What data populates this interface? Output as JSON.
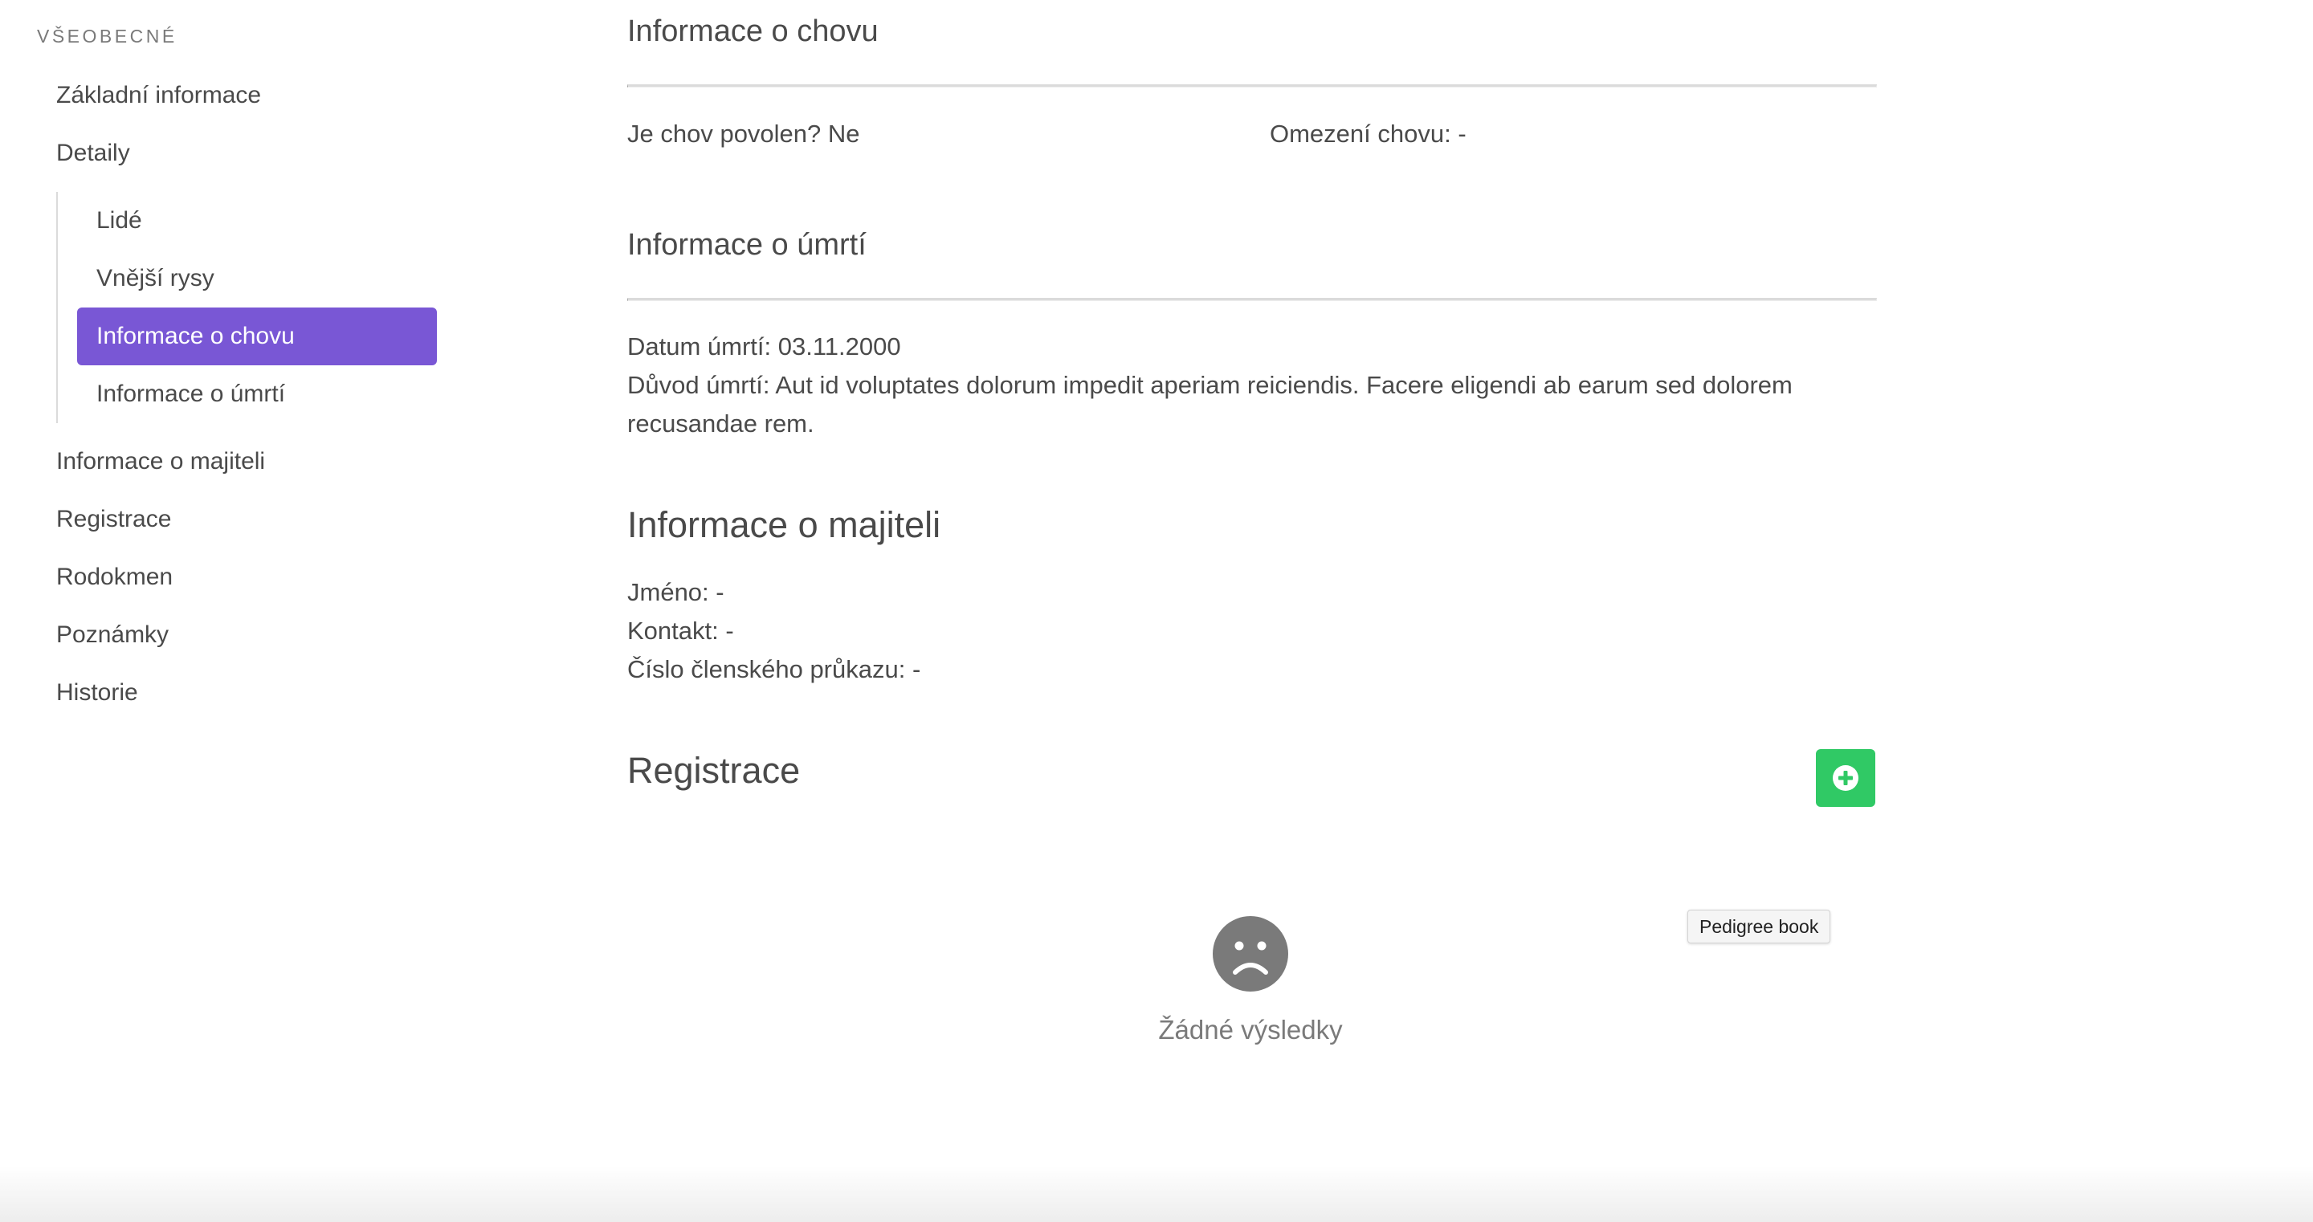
{
  "sidebar": {
    "label": "Všeobecné",
    "items": {
      "basic_info": "Základní informace",
      "details": "Detaily",
      "sub": {
        "people": "Lidé",
        "appearance": "Vnější rysy",
        "breeding_info": "Informace o chovu",
        "death_info": "Informace o úmrtí"
      },
      "owner_info": "Informace o majiteli",
      "registration": "Registrace",
      "pedigree": "Rodokmen",
      "notes": "Poznámky",
      "history": "Historie"
    },
    "active_item": "Informace o chovu",
    "active_color": "#7957d5"
  },
  "breeding": {
    "title": "Informace o chovu",
    "allowed_text": "Je chov povolen? Ne",
    "restriction_text": "Omezení chovu: -"
  },
  "death": {
    "title": "Informace o úmrtí",
    "date_text": "Datum úmrtí: 03.11.2000",
    "reason_text": "Důvod úmrtí: Aut id voluptates dolorum impedit aperiam reiciendis. Facere eligendi ab earum sed dolorem recusandae rem."
  },
  "owner": {
    "title": "Informace o majiteli",
    "name_text": "Jméno: -",
    "contact_text": "Kontakt: -",
    "card_text": "Číslo členského průkazu: -"
  },
  "registration": {
    "title": "Registrace",
    "add_button_icon": "plus-circle-icon",
    "add_button_color": "#30c965",
    "tooltip": "Pedigree book",
    "empty_icon": "sad-face-icon",
    "empty_text": "Žádné výsledky"
  }
}
